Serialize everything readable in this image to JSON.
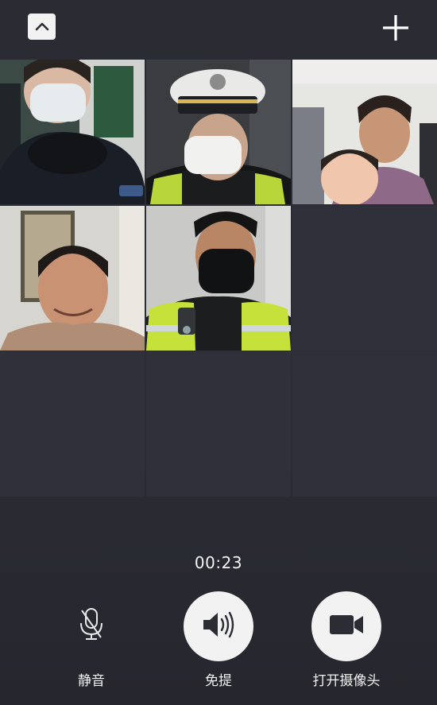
{
  "call": {
    "timer": "00:23"
  },
  "header": {
    "collapse_icon": "chevron-up-icon",
    "add_icon": "plus-icon"
  },
  "participants": [
    {
      "kind": "video",
      "description": "woman-in-mask"
    },
    {
      "kind": "video",
      "description": "police-officer-cap-mask"
    },
    {
      "kind": "video",
      "description": "grandmother-and-child"
    },
    {
      "kind": "video",
      "description": "smiling-man"
    },
    {
      "kind": "video",
      "description": "officer-black-mask-vest"
    },
    {
      "kind": "empty"
    },
    {
      "kind": "empty"
    },
    {
      "kind": "empty"
    },
    {
      "kind": "empty"
    }
  ],
  "controls": {
    "mute": {
      "label": "静音",
      "icon": "microphone-off-icon"
    },
    "speaker": {
      "label": "免提",
      "icon": "speaker-icon"
    },
    "camera": {
      "label": "打开摄像头",
      "icon": "video-camera-icon"
    }
  },
  "colors": {
    "background": "#2b2c34",
    "button_fill": "#f2f2f2",
    "icon_dark": "#2b2c34"
  }
}
